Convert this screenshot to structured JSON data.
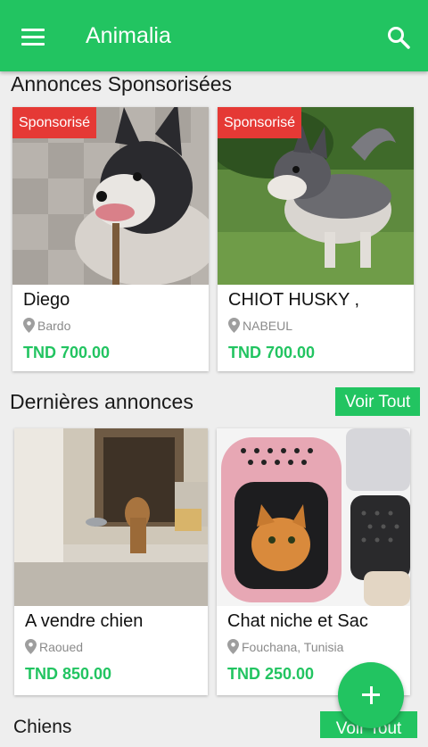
{
  "appbar": {
    "title": "Animalia"
  },
  "sponsored": {
    "title": "Annonces Sponsorisées",
    "badge": "Sponsorisé",
    "items": [
      {
        "name": "Diego",
        "location": "Bardo",
        "price": "TND 700.00"
      },
      {
        "name": "CHIOT HUSKY ,",
        "location": "NABEUL",
        "price": "TND 700.00"
      }
    ]
  },
  "latest": {
    "title": "Dernières annonces",
    "see_all": "Voir Tout",
    "items": [
      {
        "name": "A vendre chien",
        "location": "Raoued",
        "price": "TND 850.00"
      },
      {
        "name": "Chat niche et Sac",
        "location": "Fouchana, Tunisia",
        "price": "TND 250.00"
      }
    ]
  },
  "dogs": {
    "title": "Chiens",
    "see_all": "Voir Tout"
  },
  "icons": {
    "menu": "menu-icon",
    "search": "search-icon",
    "location": "location-pin-icon",
    "add": "plus-icon"
  },
  "colors": {
    "primary": "#22c461",
    "badge": "#e53935",
    "price": "#22c461"
  }
}
